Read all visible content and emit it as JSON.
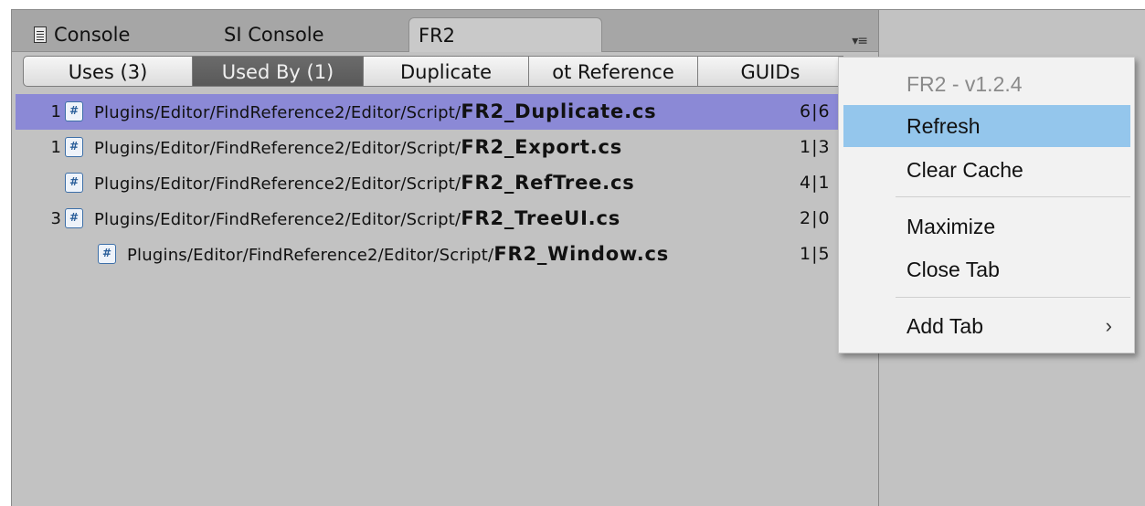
{
  "tabs": [
    {
      "label": "Console",
      "icon": "console-icon"
    },
    {
      "label": "SI Console"
    },
    {
      "label": "FR2"
    }
  ],
  "panel_menu_icon": "▾≡",
  "toolbar": {
    "buttons": [
      "Uses (3)",
      "Used By (1)",
      "Duplicate",
      "ot Reference",
      "GUIDs"
    ],
    "selected": "Used By (1)"
  },
  "rows": [
    {
      "num": "1",
      "path": "Plugins/Editor/FindReference2/Editor/Script/",
      "file": "FR2_Duplicate.cs",
      "count": "6|6"
    },
    {
      "num": "1",
      "path": "Plugins/Editor/FindReference2/Editor/Script/",
      "file": "FR2_Export.cs",
      "count": "1|3"
    },
    {
      "num": "",
      "path": "Plugins/Editor/FindReference2/Editor/Script/",
      "file": "FR2_RefTree.cs",
      "count": "4|1"
    },
    {
      "num": "3",
      "path": "Plugins/Editor/FindReference2/Editor/Script/",
      "file": "FR2_TreeUI.cs",
      "count": "2|0"
    },
    {
      "num": "",
      "path": "Plugins/Editor/FindReference2/Editor/Script/",
      "file": "FR2_Window.cs",
      "count": "1|5"
    }
  ],
  "context_menu": {
    "header": "FR2 - v1.2.4",
    "items": [
      "Refresh",
      "Clear Cache",
      "Maximize",
      "Close Tab",
      "Add Tab"
    ],
    "add_tab_chevron": "›"
  },
  "colors": {
    "selected_row": "#8b89d6",
    "menu_highlight": "#94c6ec",
    "panel_bg": "#c2c2c2"
  }
}
